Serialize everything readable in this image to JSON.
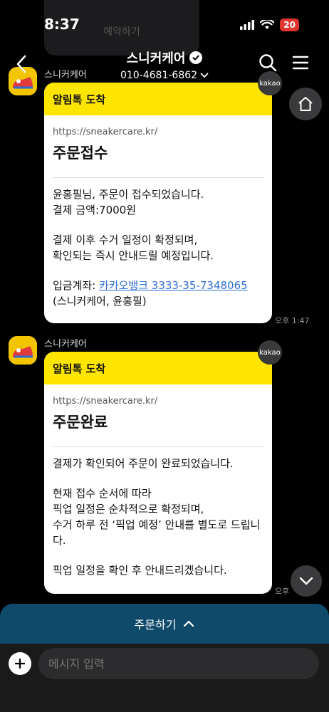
{
  "status_bar": {
    "time": "8:37",
    "battery": "20"
  },
  "ghost": {
    "text": "예약하기"
  },
  "header": {
    "title": "스니커케어",
    "phone": "010-4681-6862"
  },
  "messages": [
    {
      "sender": "스니커케어",
      "head": "알림톡 도착",
      "url": "https://sneakercare.kr/",
      "title": "주문접수",
      "para1": "윤홍필님, 주문이 접수되었습니다.\n결제 금액:7000원",
      "para2": "결제 이후 수거 일정이 확정되며,\n확인되는 즉시 안내드릴 예정입니다.",
      "para3_prefix": "입금계좌: ",
      "para3_link": "카카오뱅크 3333-35-7348065",
      "para3_suffix": " (스니커케어, 윤홍필)",
      "badge": "kakao",
      "time": "오후 1:47"
    },
    {
      "sender": "스니커케어",
      "head": "알림톡 도착",
      "url": "https://sneakercare.kr/",
      "title": "주문완료",
      "para1": "결제가 확인되어 주문이 완료되었습니다.",
      "para2": "현재 접수 순서에 따라\n픽업 일정은 순차적으로 확정되며,\n수거 하루 전 ‘픽업 예정’ 안내를 별도로 드립니다.",
      "para3": "픽업 일정을 확인 후 안내드리겠습니다.",
      "badge": "kakao",
      "time": "오후"
    }
  ],
  "order_bar": {
    "label": "주문하기"
  },
  "input": {
    "placeholder": "메시지 입력"
  }
}
